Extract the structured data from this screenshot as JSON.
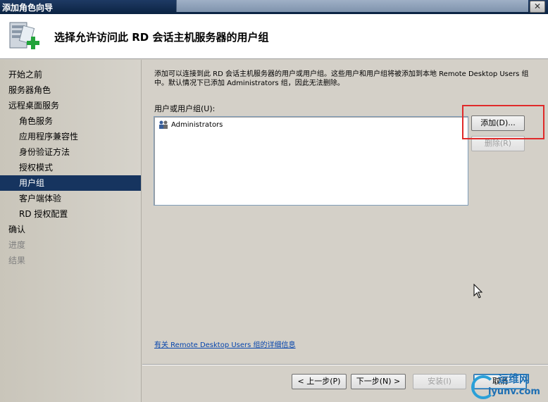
{
  "window": {
    "title": "添加角色向导",
    "close_glyph": "✕"
  },
  "header": {
    "title": "选择允许访问此 RD 会话主机服务器的用户组"
  },
  "sidebar": {
    "items": [
      {
        "label": "开始之前"
      },
      {
        "label": "服务器角色"
      },
      {
        "label": "远程桌面服务"
      },
      {
        "label": "角色服务"
      },
      {
        "label": "应用程序兼容性"
      },
      {
        "label": "身份验证方法"
      },
      {
        "label": "授权模式"
      },
      {
        "label": "用户组"
      },
      {
        "label": "客户端体验"
      },
      {
        "label": "RD 授权配置"
      },
      {
        "label": "确认"
      },
      {
        "label": "进度"
      },
      {
        "label": "结果"
      }
    ]
  },
  "main": {
    "description": "添加可以连接到此 RD 会话主机服务器的用户或用户组。这些用户和用户组将被添加到本地 Remote Desktop Users 组中。默认情况下已添加 Administrators 组，因此无法删除。",
    "list_label": "用户或用户组(U):",
    "list_items": [
      "Administrators"
    ],
    "add_button": "添加(D)...",
    "remove_button": "删除(R)",
    "more_info_link": "有关 Remote Desktop Users 组的详细信息"
  },
  "footer": {
    "prev_button": "< 上一步(P)",
    "next_button": "下一步(N) >",
    "install_button": "安装(I)",
    "cancel_button": "取消"
  },
  "watermark": {
    "cn": "运维网",
    "en": "iyunv.com"
  },
  "colors": {
    "selection": "#16345f",
    "highlight_box": "#e02a2a",
    "link": "#0645ad"
  }
}
